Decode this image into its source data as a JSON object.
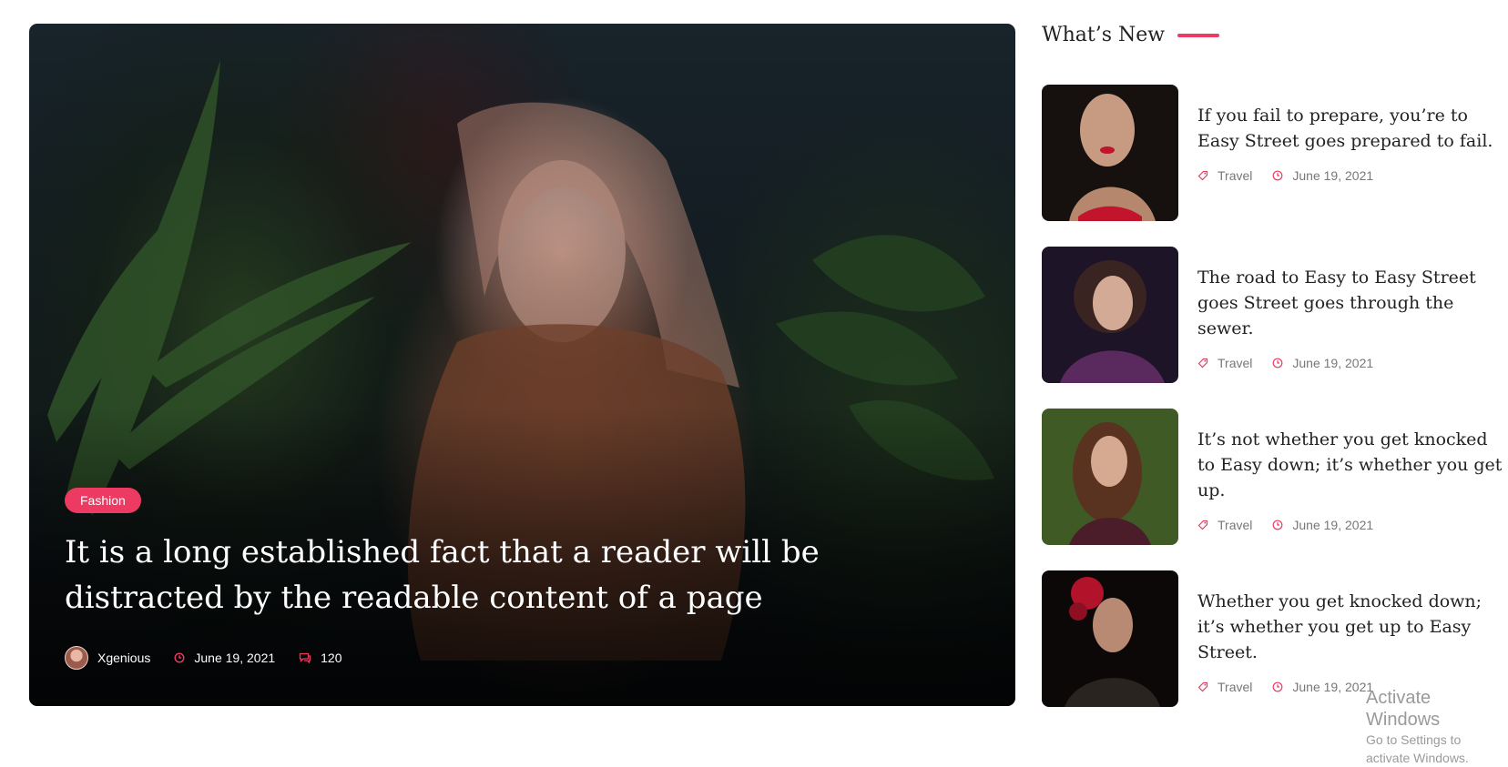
{
  "featured": {
    "category": "Fashion",
    "title": "It is a long established fact that a reader will be distracted by the readable content of a page",
    "author": "Xgenious",
    "date": "June 19, 2021",
    "comments": "120"
  },
  "sidebar": {
    "heading": "What’s New",
    "accent_color": "#ec3a63",
    "posts": [
      {
        "title": "If you fail to prepare, you’re to Easy Street goes prepared to fail.",
        "category": "Travel",
        "date": "June 19, 2021"
      },
      {
        "title": "The road to Easy to Easy Street goes Street goes through the sewer.",
        "category": "Travel",
        "date": "June 19, 2021"
      },
      {
        "title": "It’s not whether you get knocked to Easy down; it’s whether you get up.",
        "category": "Travel",
        "date": "June 19, 2021"
      },
      {
        "title": "Whether you get knocked down; it’s whether you get up to Easy Street.",
        "category": "Travel",
        "date": "June 19, 2021"
      }
    ]
  },
  "watermark": {
    "title": "Activate Windows",
    "subtitle": "Go to Settings to activate Windows."
  }
}
